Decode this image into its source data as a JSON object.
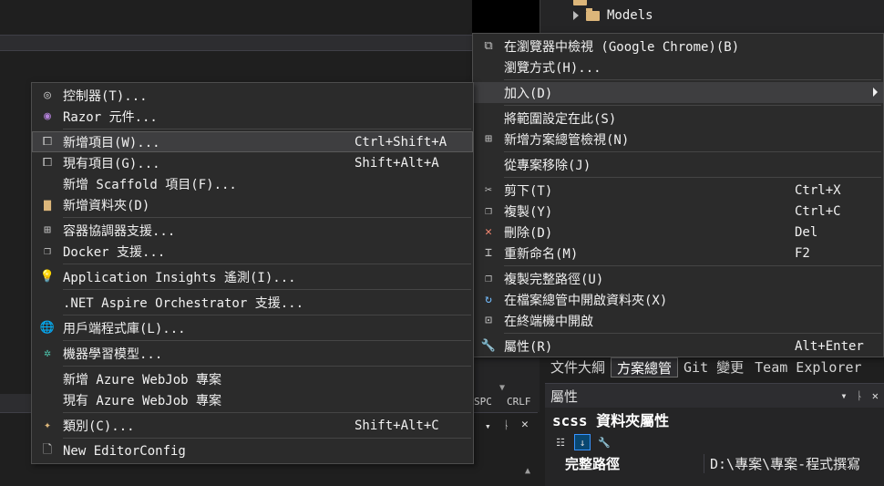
{
  "solution_tree": {
    "models_label": "Models"
  },
  "status_bar": {
    "spc": "SPC",
    "crlf": "CRLF"
  },
  "context_menu_left": {
    "items": [
      {
        "label": "控制器(T)...",
        "shortcut": "",
        "icon": "controller-icon"
      },
      {
        "label": "Razor 元件...",
        "shortcut": "",
        "icon": "razor-icon"
      },
      {
        "label": "新增項目(W)...",
        "shortcut": "Ctrl+Shift+A",
        "icon": "new-item-icon"
      },
      {
        "label": "現有項目(G)...",
        "shortcut": "Shift+Alt+A",
        "icon": "existing-item-icon"
      },
      {
        "label": "新增 Scaffold 項目(F)...",
        "shortcut": "",
        "icon": ""
      },
      {
        "label": "新增資料夾(D)",
        "shortcut": "",
        "icon": "new-folder-icon"
      },
      {
        "label": "容器協調器支援...",
        "shortcut": "",
        "icon": "container-icon"
      },
      {
        "label": "Docker 支援...",
        "shortcut": "",
        "icon": "docker-icon"
      },
      {
        "label": "Application Insights 遙測(I)...",
        "shortcut": "",
        "icon": "insights-icon"
      },
      {
        "label": ".NET Aspire Orchestrator 支援...",
        "shortcut": "",
        "icon": ""
      },
      {
        "label": "用戶端程式庫(L)...",
        "shortcut": "",
        "icon": "globe-icon"
      },
      {
        "label": "機器學習模型...",
        "shortcut": "",
        "icon": "ml-icon"
      },
      {
        "label": "新增 Azure WebJob 專案",
        "shortcut": "",
        "icon": ""
      },
      {
        "label": "現有 Azure WebJob 專案",
        "shortcut": "",
        "icon": ""
      },
      {
        "label": "類別(C)...",
        "shortcut": "Shift+Alt+C",
        "icon": "class-icon"
      },
      {
        "label": "New EditorConfig",
        "shortcut": "",
        "icon": "editorconfig-icon"
      }
    ]
  },
  "context_menu_right": {
    "items": [
      {
        "label": "在瀏覽器中檢視 (Google Chrome)(B)",
        "shortcut": "",
        "icon": "browser-icon"
      },
      {
        "label": "瀏覽方式(H)...",
        "shortcut": "",
        "icon": ""
      },
      {
        "label": "加入(D)",
        "shortcut": "",
        "icon": ""
      },
      {
        "label": "將範圍設定在此(S)",
        "shortcut": "",
        "icon": ""
      },
      {
        "label": "新增方案總管檢視(N)",
        "shortcut": "",
        "icon": "new-view-icon"
      },
      {
        "label": "從專案移除(J)",
        "shortcut": "",
        "icon": ""
      },
      {
        "label": "剪下(T)",
        "shortcut": "Ctrl+X",
        "icon": "cut-icon"
      },
      {
        "label": "複製(Y)",
        "shortcut": "Ctrl+C",
        "icon": "copy-icon"
      },
      {
        "label": "刪除(D)",
        "shortcut": "Del",
        "icon": "delete-icon"
      },
      {
        "label": "重新命名(M)",
        "shortcut": "F2",
        "icon": "rename-icon"
      },
      {
        "label": "複製完整路徑(U)",
        "shortcut": "",
        "icon": "copy-path-icon"
      },
      {
        "label": "在檔案總管中開啟資料夾(X)",
        "shortcut": "",
        "icon": "open-folder-icon"
      },
      {
        "label": "在終端機中開啟",
        "shortcut": "",
        "icon": "terminal-icon"
      },
      {
        "label": "屬性(R)",
        "shortcut": "Alt+Enter",
        "icon": "wrench-icon"
      }
    ]
  },
  "right_tabs": [
    "文件大綱",
    "方案總管",
    "Git 變更",
    "Team Explorer"
  ],
  "properties_panel": {
    "header": "屬性",
    "title": "scss 資料夾屬性",
    "row_key": "完整路徑",
    "row_value": "D:\\專案\\專案-程式撰寫"
  }
}
